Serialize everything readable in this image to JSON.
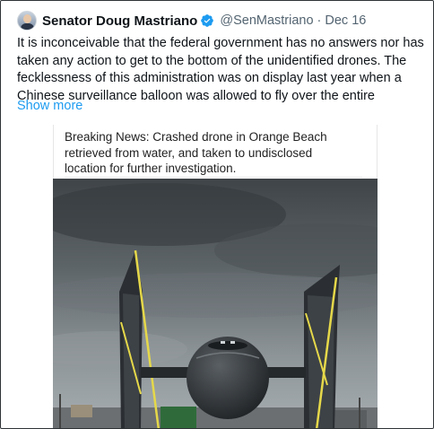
{
  "tweet": {
    "author_name": "Senator Doug Mastriano",
    "handle": "@SenMastriano",
    "separator": "·",
    "date": "Dec 16",
    "text": "It is inconceivable that the federal government has no answers nor has taken any action to get to the bottom of the unidentified drones. The fecklessness of this administration was on display last year when a Chinese surveillance balloon was allowed to fly over the entire",
    "show_more_label": "Show more",
    "verified_color": "#1d9bf0"
  },
  "media": {
    "caption": "Breaking News: Crashed drone in Orange Beach retrieved from water, and taken to undisclosed location for further investigation."
  }
}
